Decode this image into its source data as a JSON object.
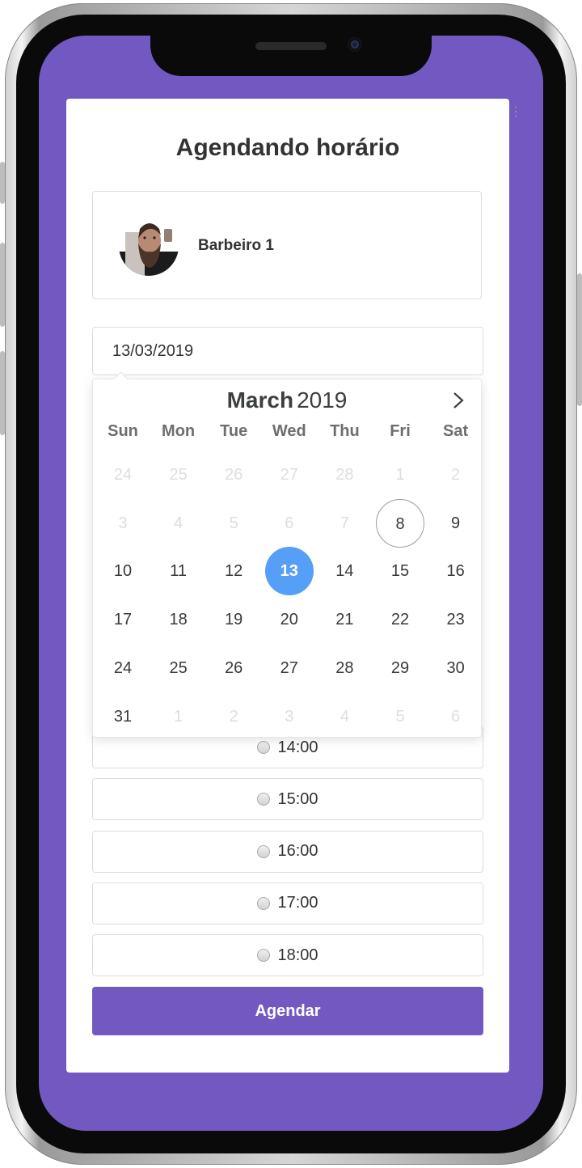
{
  "page": {
    "title": "Agendando horário"
  },
  "barber": {
    "name": "Barbeiro 1"
  },
  "date_input": {
    "value": "13/03/2019"
  },
  "calendar": {
    "month": "March",
    "year": "2019",
    "weekdays": [
      "Sun",
      "Mon",
      "Tue",
      "Wed",
      "Thu",
      "Fri",
      "Sat"
    ],
    "weeks": [
      [
        "24",
        "25",
        "26",
        "27",
        "28",
        "1",
        "2"
      ],
      [
        "3",
        "4",
        "5",
        "6",
        "7",
        "8",
        "9"
      ],
      [
        "10",
        "11",
        "12",
        "13",
        "14",
        "15",
        "16"
      ],
      [
        "17",
        "18",
        "19",
        "20",
        "21",
        "22",
        "23"
      ],
      [
        "24",
        "25",
        "26",
        "27",
        "28",
        "29",
        "30"
      ],
      [
        "31",
        "1",
        "2",
        "3",
        "4",
        "5",
        "6"
      ]
    ],
    "today": "8",
    "selected": "13",
    "selected_color": "#569ff7"
  },
  "time_slots": [
    "14:00",
    "15:00",
    "16:00",
    "17:00",
    "18:00"
  ],
  "submit": {
    "label": "Agendar"
  },
  "colors": {
    "brand": "#7159c1"
  }
}
